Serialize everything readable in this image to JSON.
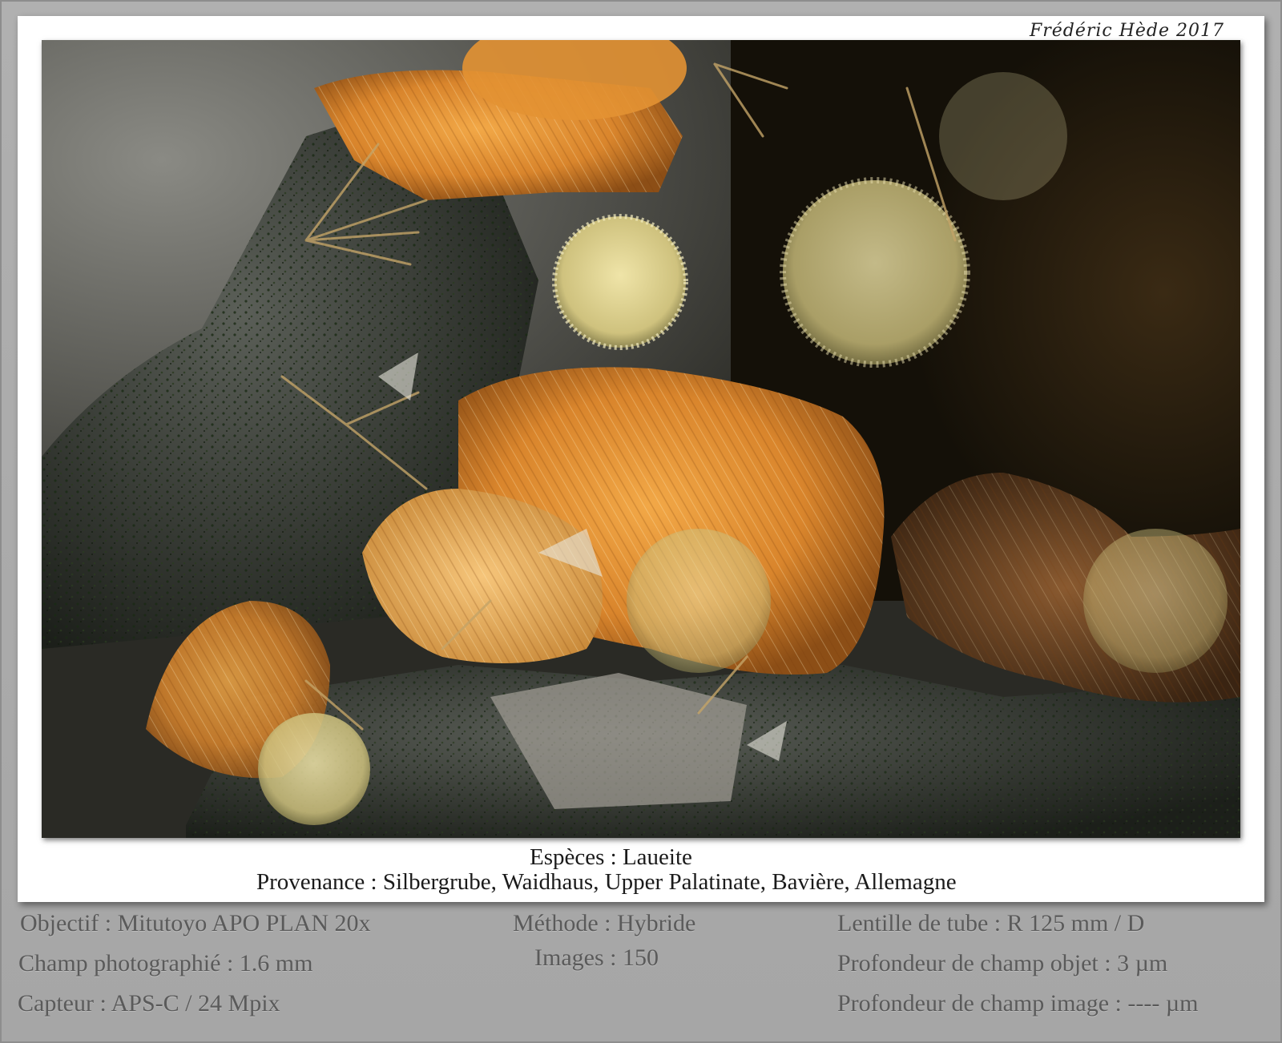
{
  "signature": "Frédéric Hède 2017",
  "caption": {
    "species": "Espèces : Laueite",
    "origin": "Provenance : Silbergrube, Waidhaus, Upper Palatinate, Bavière, Allemagne"
  },
  "info": {
    "objective": "Objectif : Mitutoyo APO PLAN 20x",
    "field": "Champ photographié : 1.6 mm",
    "sensor": "Capteur : APS-C / 24 Mpix",
    "method": "Méthode : Hybride",
    "images": "Images : 150",
    "tube_lens": "Lentille de tube : R 125 mm / D",
    "depth_object": "Profondeur de champ objet : 3 µm",
    "depth_image": "Profondeur de champ image : ---- µm"
  }
}
